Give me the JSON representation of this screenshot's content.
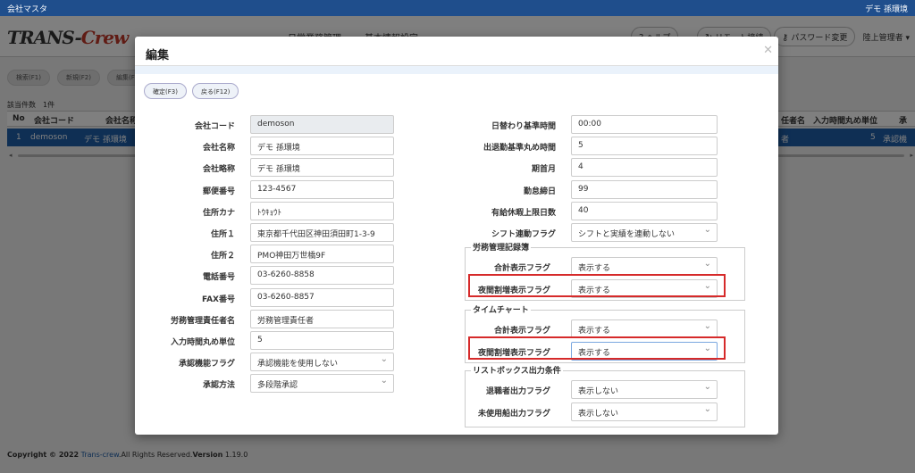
{
  "topbar": {
    "title": "会社マスタ",
    "company": "デモ 孫環境"
  },
  "header": {
    "logo_main": "TRANS-",
    "logo_accent": "Crew",
    "nav": [
      "日常業務管理",
      "基本情報設定"
    ],
    "help_label": "ヘルプ",
    "remote_label": "リモート接続",
    "password_label": "パスワード変更",
    "user_label": "陸上管理者"
  },
  "toolbar": {
    "search": "検索(F1)",
    "new": "新規(F2)",
    "edit": "編集(F"
  },
  "list": {
    "count_label": "該当件数",
    "count_value": "1件",
    "headers": {
      "no": "No",
      "code": "会社コード",
      "name": "会社名称",
      "manager": "任者名",
      "rounding": "入力時間丸め単位",
      "approval": "承"
    },
    "row": {
      "no": "1",
      "code": "demoson",
      "name": "デモ 孫環境",
      "manager": "者",
      "rounding": "5",
      "approval": "承認機"
    }
  },
  "footer": {
    "copyright": "Copyright © 2022",
    "link": "Trans-crew",
    "rights": ".All Rights Reserved.",
    "version_label": "Version",
    "version": " 1.19.0"
  },
  "modal": {
    "title": "編集",
    "confirm_button": "確定(F3)",
    "back_button": "戻る(F12)",
    "left_fields": [
      {
        "label": "会社コード",
        "value": "demoson"
      },
      {
        "label": "会社名称",
        "value": "デモ 孫環境"
      },
      {
        "label": "会社略称",
        "value": "デモ 孫環境"
      },
      {
        "label": "郵便番号",
        "value": "123-4567"
      },
      {
        "label": "住所カナ",
        "value": "ﾄｳｷｮｳﾄ"
      },
      {
        "label": "住所１",
        "value": "東京都千代田区神田須田町1-3-9"
      },
      {
        "label": "住所２",
        "value": "PMO神田万世橋9F"
      },
      {
        "label": "電話番号",
        "value": "03-6260-8858"
      },
      {
        "label": "FAX番号",
        "value": "03-6260-8857"
      },
      {
        "label": "労務管理責任者名",
        "value": "労務管理責任者"
      },
      {
        "label": "入力時間丸め単位",
        "value": "5"
      },
      {
        "label": "承認機能フラグ",
        "value": "承認機能を使用しない"
      },
      {
        "label": "承認方法",
        "value": "多段階承認"
      }
    ],
    "right_fields": [
      {
        "label": "日替わり基準時間",
        "value": "00:00"
      },
      {
        "label": "出退勤基準丸め時間",
        "value": "5"
      },
      {
        "label": "期首月",
        "value": "4"
      },
      {
        "label": "勤怠締日",
        "value": "99"
      },
      {
        "label": "有給休暇上限日数",
        "value": "40"
      },
      {
        "label": "シフト連動フラグ",
        "value": "シフトと実績を連動しない"
      }
    ],
    "groups": [
      {
        "title": "労務管理記録簿",
        "fields": [
          {
            "label": "合計表示フラグ",
            "value": "表示する"
          },
          {
            "label": "夜間割増表示フラグ",
            "value": "表示する"
          }
        ]
      },
      {
        "title": "タイムチャート",
        "fields": [
          {
            "label": "合計表示フラグ",
            "value": "表示する"
          },
          {
            "label": "夜間割増表示フラグ",
            "value": "表示する"
          }
        ]
      },
      {
        "title": "リストボックス出力条件",
        "fields": [
          {
            "label": "退職者出力フラグ",
            "value": "表示しない"
          },
          {
            "label": "未使用船出力フラグ",
            "value": "表示しない"
          }
        ]
      }
    ]
  }
}
